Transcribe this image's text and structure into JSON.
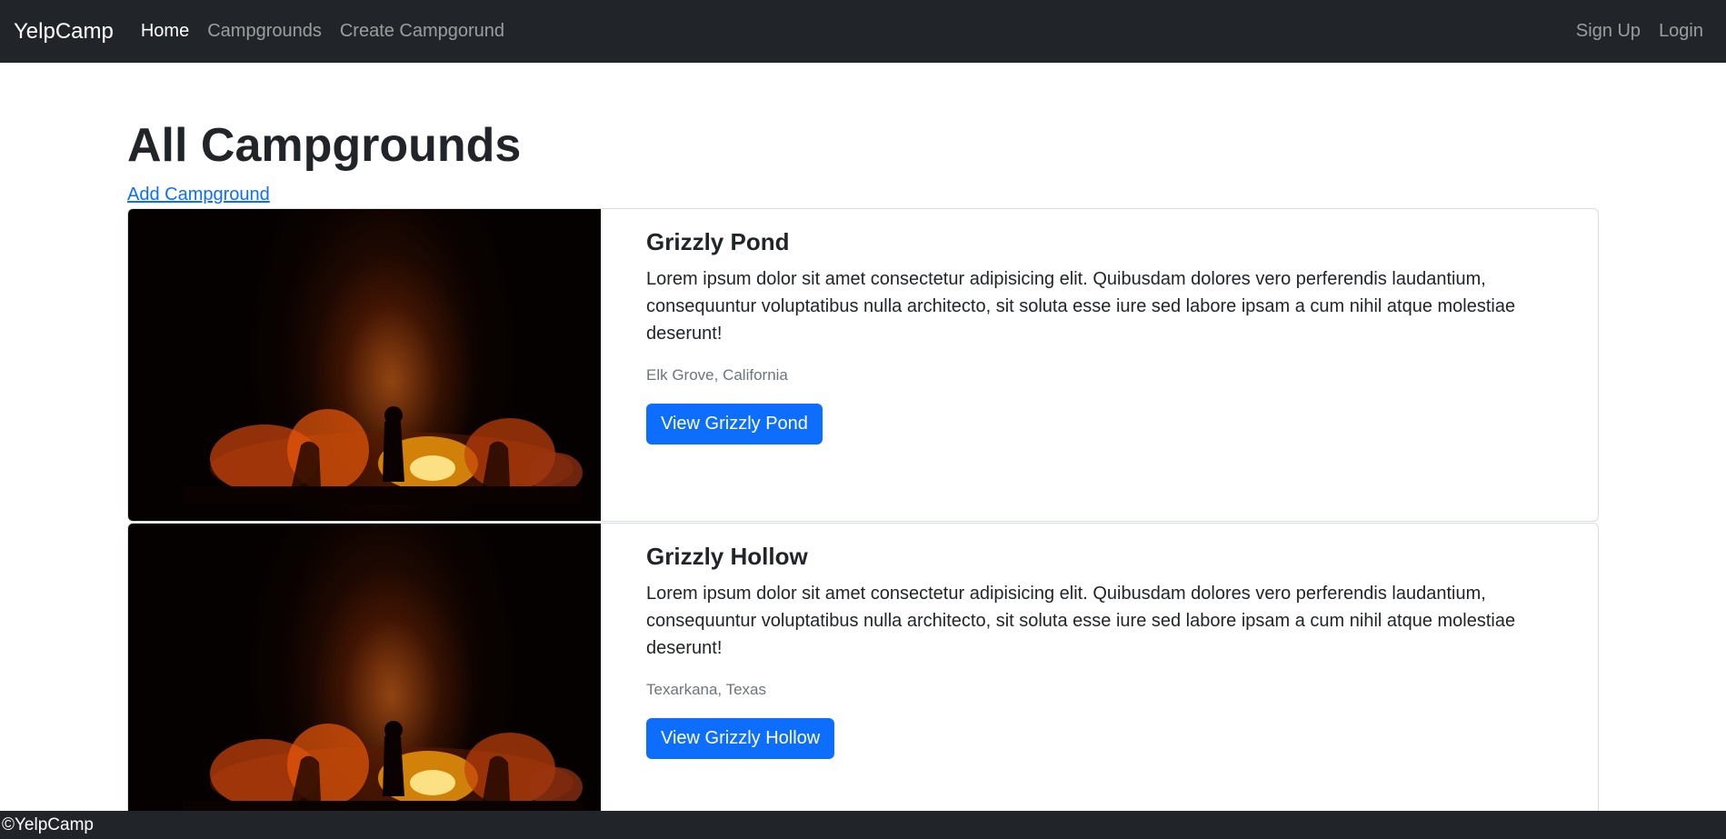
{
  "navbar": {
    "brand": "YelpCamp",
    "links": [
      {
        "label": "Home",
        "active": true
      },
      {
        "label": "Campgrounds",
        "active": false
      },
      {
        "label": "Create Campgorund",
        "active": false
      }
    ],
    "right_links": [
      {
        "label": "Sign Up"
      },
      {
        "label": "Login"
      }
    ]
  },
  "main": {
    "title": "All Campgrounds",
    "add_link": "Add Campground",
    "campgrounds": [
      {
        "title": "Grizzly Pond",
        "description": "Lorem ipsum dolor sit amet consectetur adipisicing elit. Quibusdam dolores vero perferendis laudantium, consequuntur voluptatibus nulla architecto, sit soluta esse iure sed labore ipsam a cum nihil atque molestiae deserunt!",
        "location": "Elk Grove, California",
        "button": "View Grizzly Pond"
      },
      {
        "title": "Grizzly Hollow",
        "description": "Lorem ipsum dolor sit amet consectetur adipisicing elit. Quibusdam dolores vero perferendis laudantium, consequuntur voluptatibus nulla architecto, sit soluta esse iure sed labore ipsam a cum nihil atque molestiae deserunt!",
        "location": "Texarkana, Texas",
        "button": "View Grizzly Hollow"
      }
    ]
  },
  "footer": {
    "text": "©YelpCamp"
  },
  "colors": {
    "navbar_bg": "#212529",
    "primary": "#0d6efd",
    "muted": "#6c757d"
  }
}
